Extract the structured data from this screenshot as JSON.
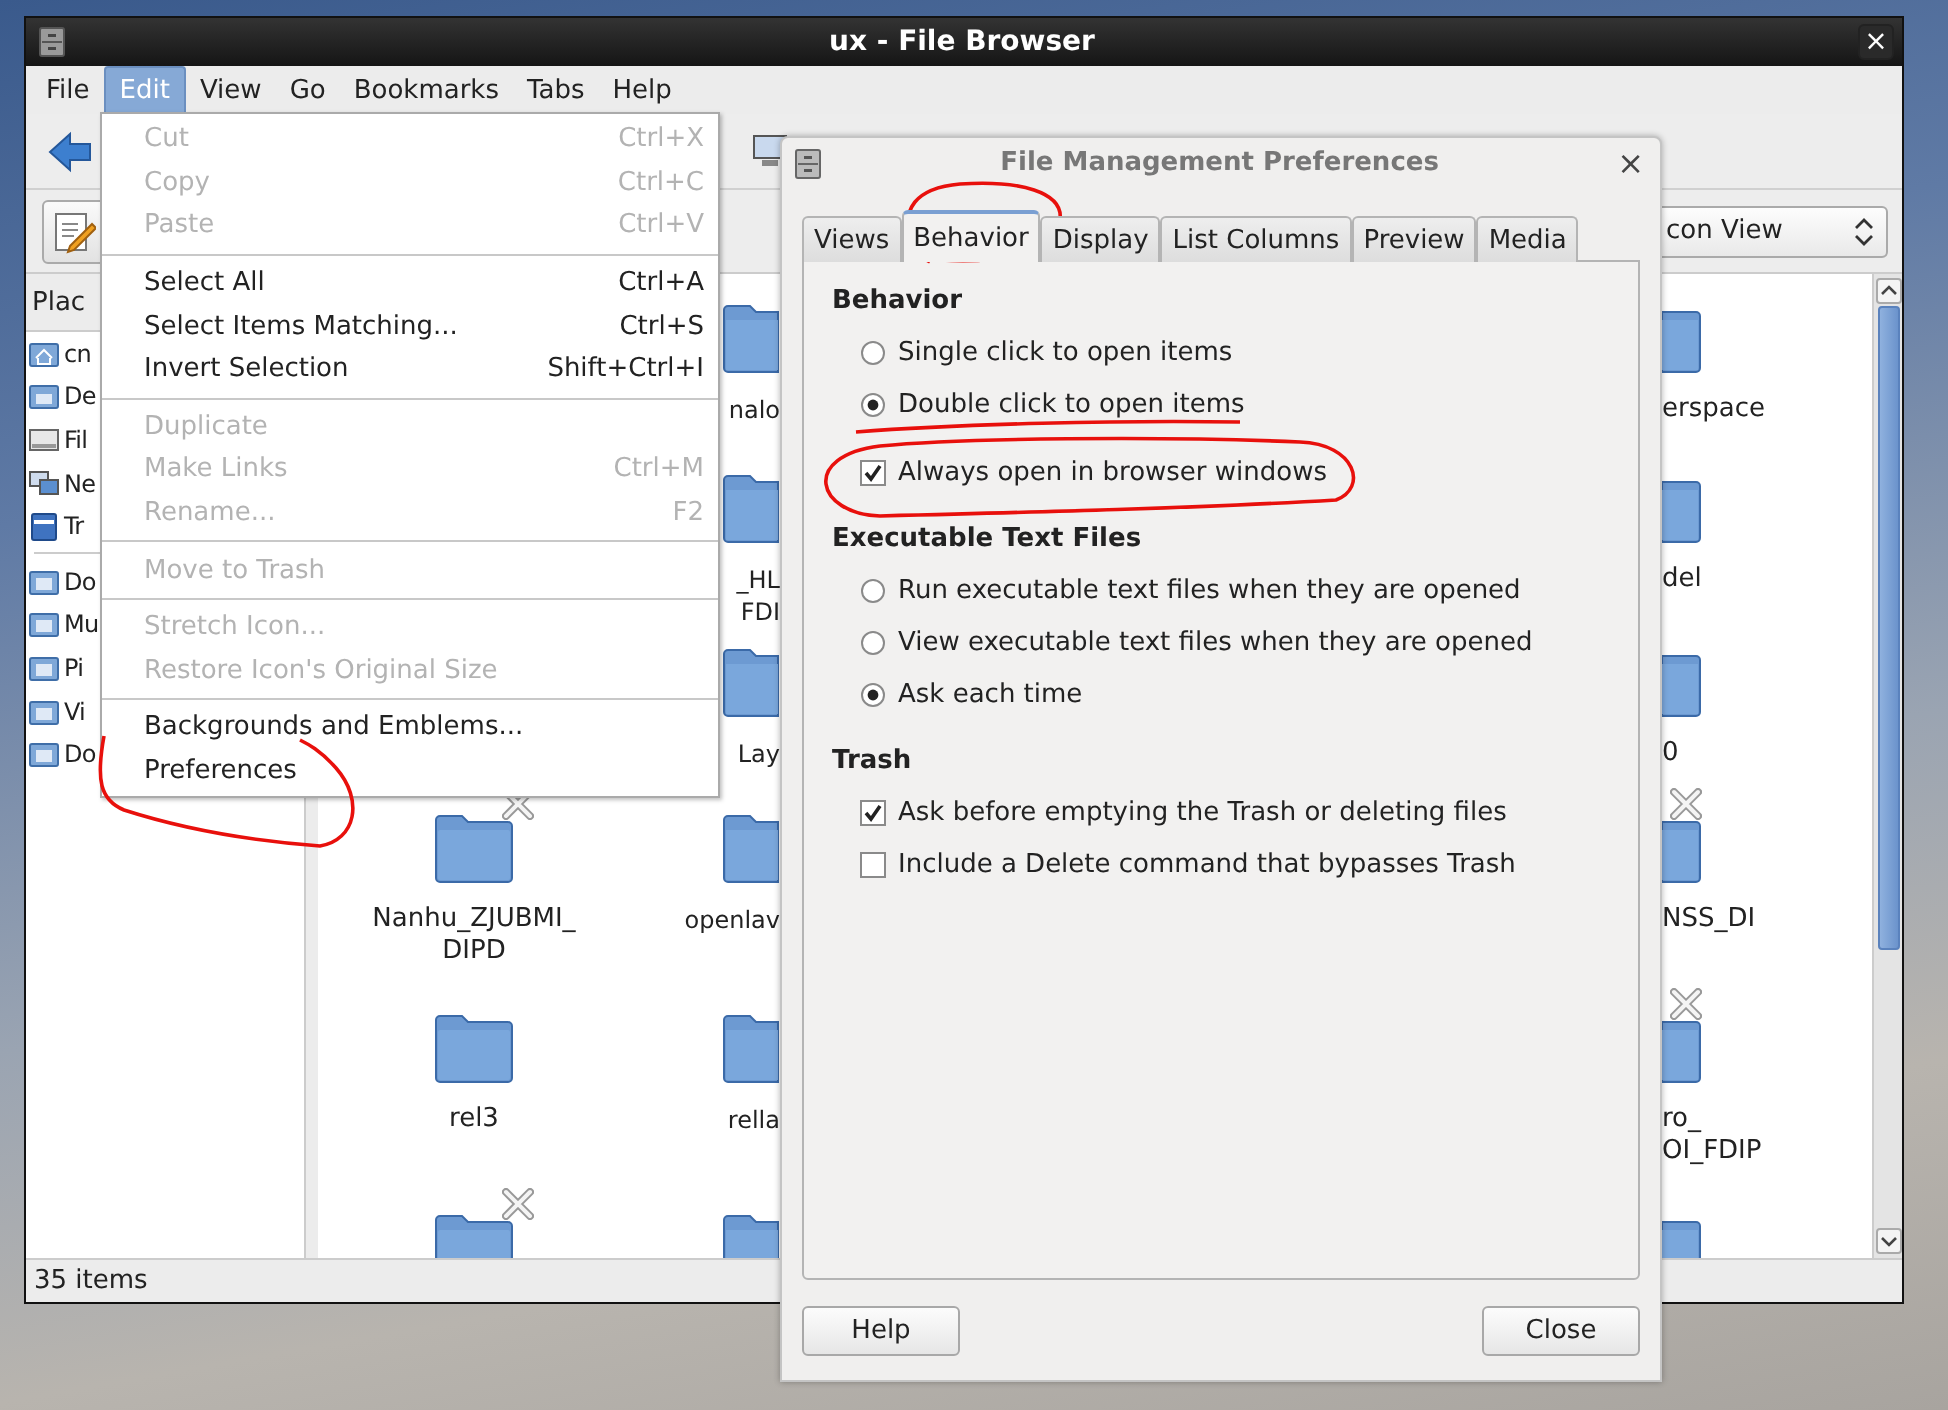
{
  "window": {
    "title": "ux - File Browser",
    "close": "×"
  },
  "menubar": [
    {
      "label": "File",
      "selected": false
    },
    {
      "label": "Edit",
      "selected": true
    },
    {
      "label": "View",
      "selected": false
    },
    {
      "label": "Go",
      "selected": false
    },
    {
      "label": "Bookmarks",
      "selected": false
    },
    {
      "label": "Tabs",
      "selected": false
    },
    {
      "label": "Help",
      "selected": false
    }
  ],
  "view_selector": {
    "value": "con View"
  },
  "sidebar": {
    "header": "Plac",
    "groups": [
      [
        {
          "label": "cn",
          "kind": "home"
        },
        {
          "label": "De",
          "kind": "desktop"
        },
        {
          "label": "Fil",
          "kind": "drive"
        },
        {
          "label": "Ne",
          "kind": "network"
        },
        {
          "label": "Tr",
          "kind": "trash"
        }
      ],
      [
        {
          "label": "Do",
          "kind": "folder"
        },
        {
          "label": "Mu",
          "kind": "folder"
        },
        {
          "label": "Pi",
          "kind": "folder"
        },
        {
          "label": "Vi",
          "kind": "folder"
        },
        {
          "label": "Do",
          "kind": "folder"
        }
      ]
    ]
  },
  "file_columns": [
    [
      {
        "lines": [
          "Nanhu_ZJUBMI_",
          "DIPD"
        ],
        "emblem": true
      },
      {
        "lines": [
          "rel3"
        ],
        "emblem": false
      },
      {
        "emblem": true
      }
    ],
    [
      {
        "lines": [
          "nalo"
        ],
        "emblem": false
      },
      {
        "lines": [
          "_HL",
          "FDI"
        ],
        "emblem": false
      },
      {
        "lines": [
          "Lay"
        ],
        "emblem": false
      },
      {
        "lines": [
          "openlav"
        ],
        "emblem": false
      },
      {
        "lines": [
          "rella"
        ],
        "emblem": false
      },
      {
        "emblem": false
      }
    ],
    [
      {
        "lines": [
          "erspace"
        ],
        "emblem": false
      },
      {
        "lines": [
          "del"
        ],
        "emblem": false
      },
      {
        "lines": [
          "0"
        ],
        "emblem": false
      },
      {
        "lines": [
          "NSS_DI"
        ],
        "emblem": true
      },
      {
        "lines": [
          "ro_",
          "OI_FDIP"
        ],
        "emblem": true
      },
      {
        "emblem": false
      }
    ]
  ],
  "status_bar": "35 items",
  "edit_menu": {
    "groups": [
      [
        {
          "label": "Cut",
          "shortcut": "Ctrl+X",
          "disabled": true
        },
        {
          "label": "Copy",
          "shortcut": "Ctrl+C",
          "disabled": true
        },
        {
          "label": "Paste",
          "shortcut": "Ctrl+V",
          "disabled": true
        }
      ],
      [
        {
          "label": "Select All",
          "shortcut": "Ctrl+A",
          "disabled": false
        },
        {
          "label": "Select Items Matching...",
          "shortcut": "Ctrl+S",
          "disabled": false
        },
        {
          "label": "Invert Selection",
          "shortcut": "Shift+Ctrl+I",
          "disabled": false
        }
      ],
      [
        {
          "label": "Duplicate",
          "disabled": true
        },
        {
          "label": "Make Links",
          "shortcut": "Ctrl+M",
          "disabled": true
        },
        {
          "label": "Rename...",
          "shortcut": "F2",
          "disabled": true
        }
      ],
      [
        {
          "label": "Move to Trash",
          "disabled": true
        }
      ],
      [
        {
          "label": "Stretch Icon...",
          "disabled": true
        },
        {
          "label": "Restore Icon's Original Size",
          "disabled": true
        }
      ],
      [
        {
          "label": "Backgrounds and Emblems...",
          "disabled": false
        },
        {
          "label": "Preferences",
          "disabled": false
        }
      ]
    ]
  },
  "dialog": {
    "title": "File Management Preferences",
    "close": "×",
    "tabs": [
      {
        "label": "Views",
        "selected": false
      },
      {
        "label": "Behavior",
        "selected": true
      },
      {
        "label": "Display",
        "selected": false
      },
      {
        "label": "List Columns",
        "selected": false
      },
      {
        "label": "Preview",
        "selected": false
      },
      {
        "label": "Media",
        "selected": false
      }
    ],
    "sections": [
      {
        "heading": "Behavior",
        "options": [
          {
            "kind": "radio",
            "label": "Single click to open items",
            "checked": false
          },
          {
            "kind": "radio",
            "label": "Double click to open items",
            "checked": true
          },
          {
            "kind": "checkbox",
            "label": "Always open in browser windows",
            "checked": true
          }
        ]
      },
      {
        "heading": "Executable Text Files",
        "options": [
          {
            "kind": "radio",
            "label": "Run executable text files when they are opened",
            "checked": false
          },
          {
            "kind": "radio",
            "label": "View executable text files when they are opened",
            "checked": false
          },
          {
            "kind": "radio",
            "label": "Ask each time",
            "checked": true
          }
        ]
      },
      {
        "heading": "Trash",
        "options": [
          {
            "kind": "checkbox",
            "label": "Ask before emptying the Trash or deleting files",
            "checked": true
          },
          {
            "kind": "checkbox",
            "label": "Include a Delete command that bypasses Trash",
            "checked": false
          }
        ]
      }
    ],
    "buttons": [
      "Help",
      "Close"
    ]
  }
}
